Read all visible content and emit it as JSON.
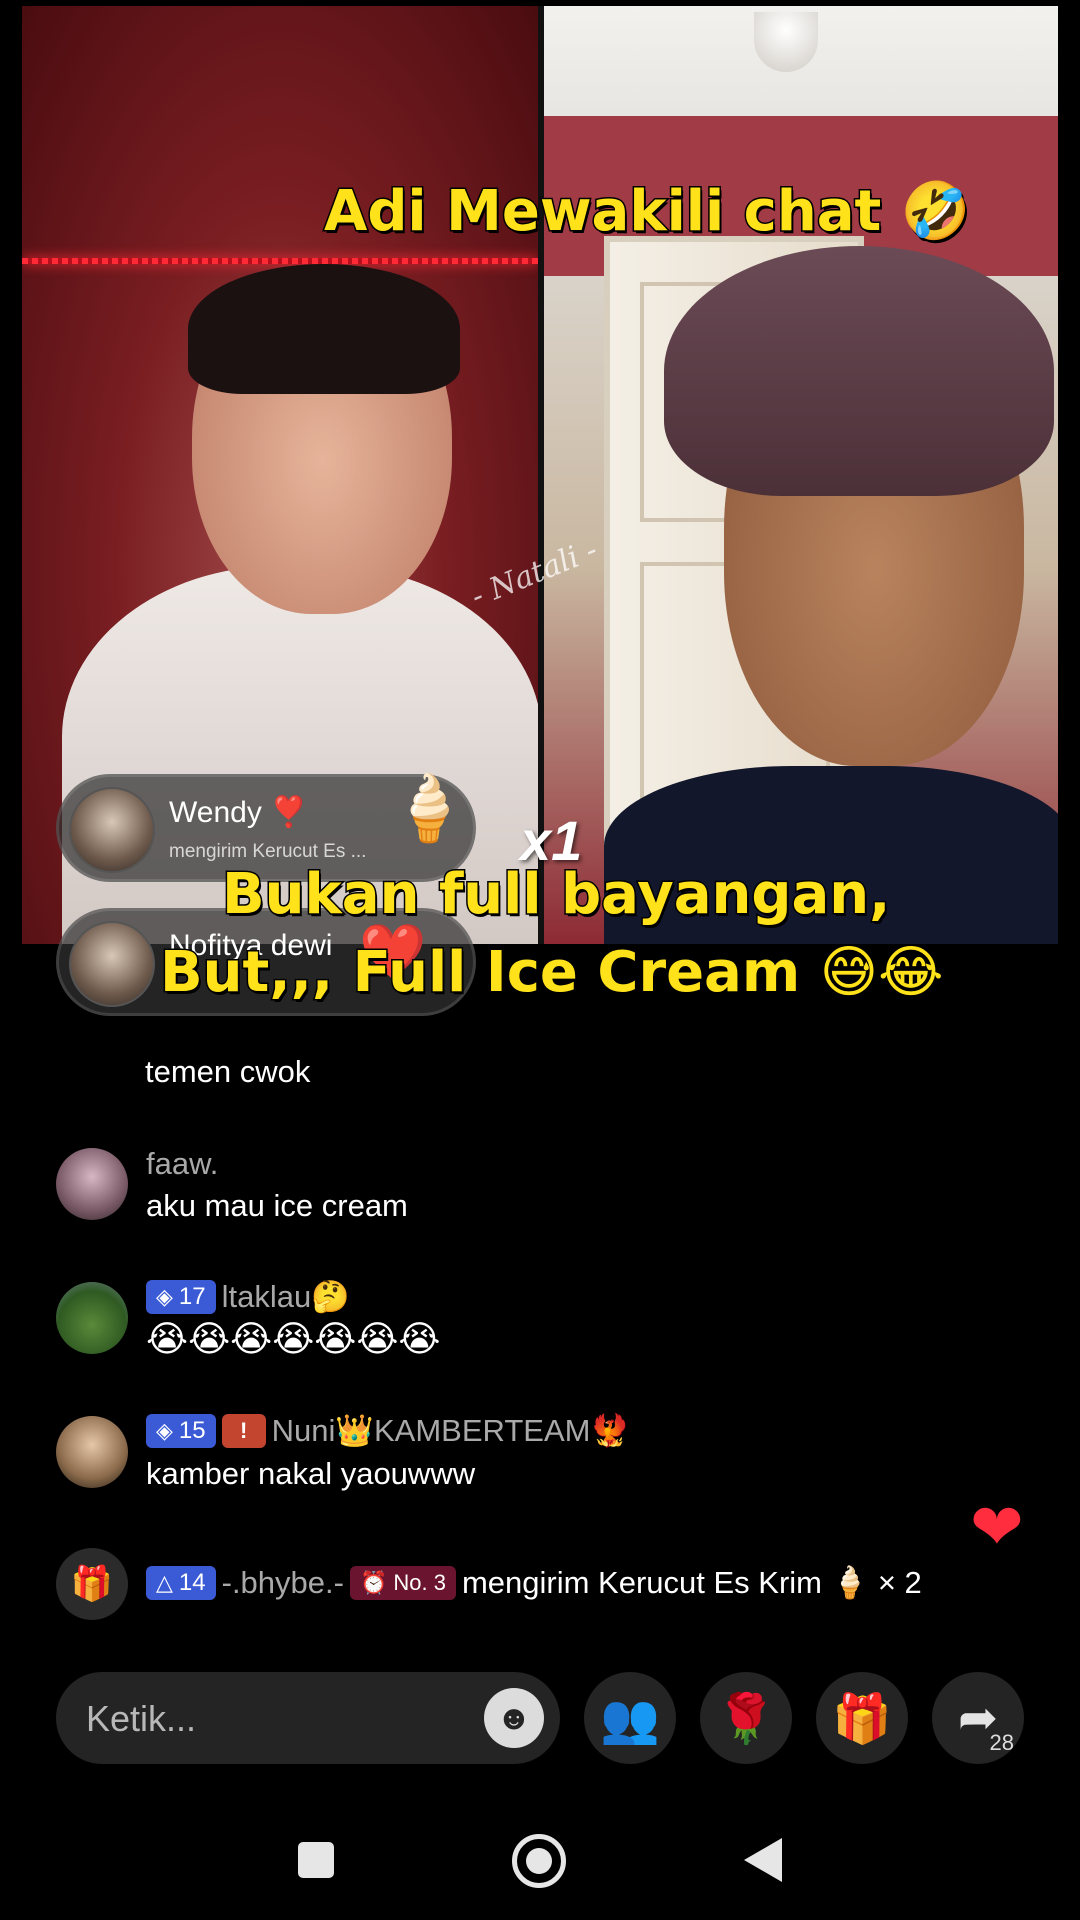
{
  "video": {
    "watermark": "- Natali -",
    "caption_top": "Adi Mewakili chat 🤣",
    "caption_mid": "Bukan full bayangan,",
    "caption_low": "But,,, Full Ice Cream 😅😂",
    "gift_multiplier": "x1"
  },
  "gift_notifications": [
    {
      "name": "Wendy ❣️",
      "subtitle": "mengirim Kerucut Es ...",
      "gift_emoji": "🍦"
    },
    {
      "name": "Nofitya dewi",
      "subtitle": "",
      "gift_emoji": "❤️"
    }
  ],
  "chat": [
    {
      "user": "",
      "text": "temen cwok"
    },
    {
      "user": "faaw.",
      "text": "aku mau ice cream"
    },
    {
      "user": "ltaklau🤔",
      "level": "17",
      "text": "😭😭😭😭😭😭😭"
    },
    {
      "user": "Nuni👑KAMBERTEAM🐦‍🔥",
      "level": "15",
      "text": "kamber nakal yaouwww"
    }
  ],
  "gift_event": {
    "level": "14",
    "user": "-.bhybe.-",
    "rank": "No. 3",
    "text": "mengirim Kerucut Es Krim 🍦 × 2"
  },
  "input": {
    "placeholder": "Ketik..."
  },
  "share_count": "28",
  "colors": {
    "caption": "#ffe21a",
    "level_badge": "#3b5bd6",
    "heart": "#ff2d3d"
  }
}
